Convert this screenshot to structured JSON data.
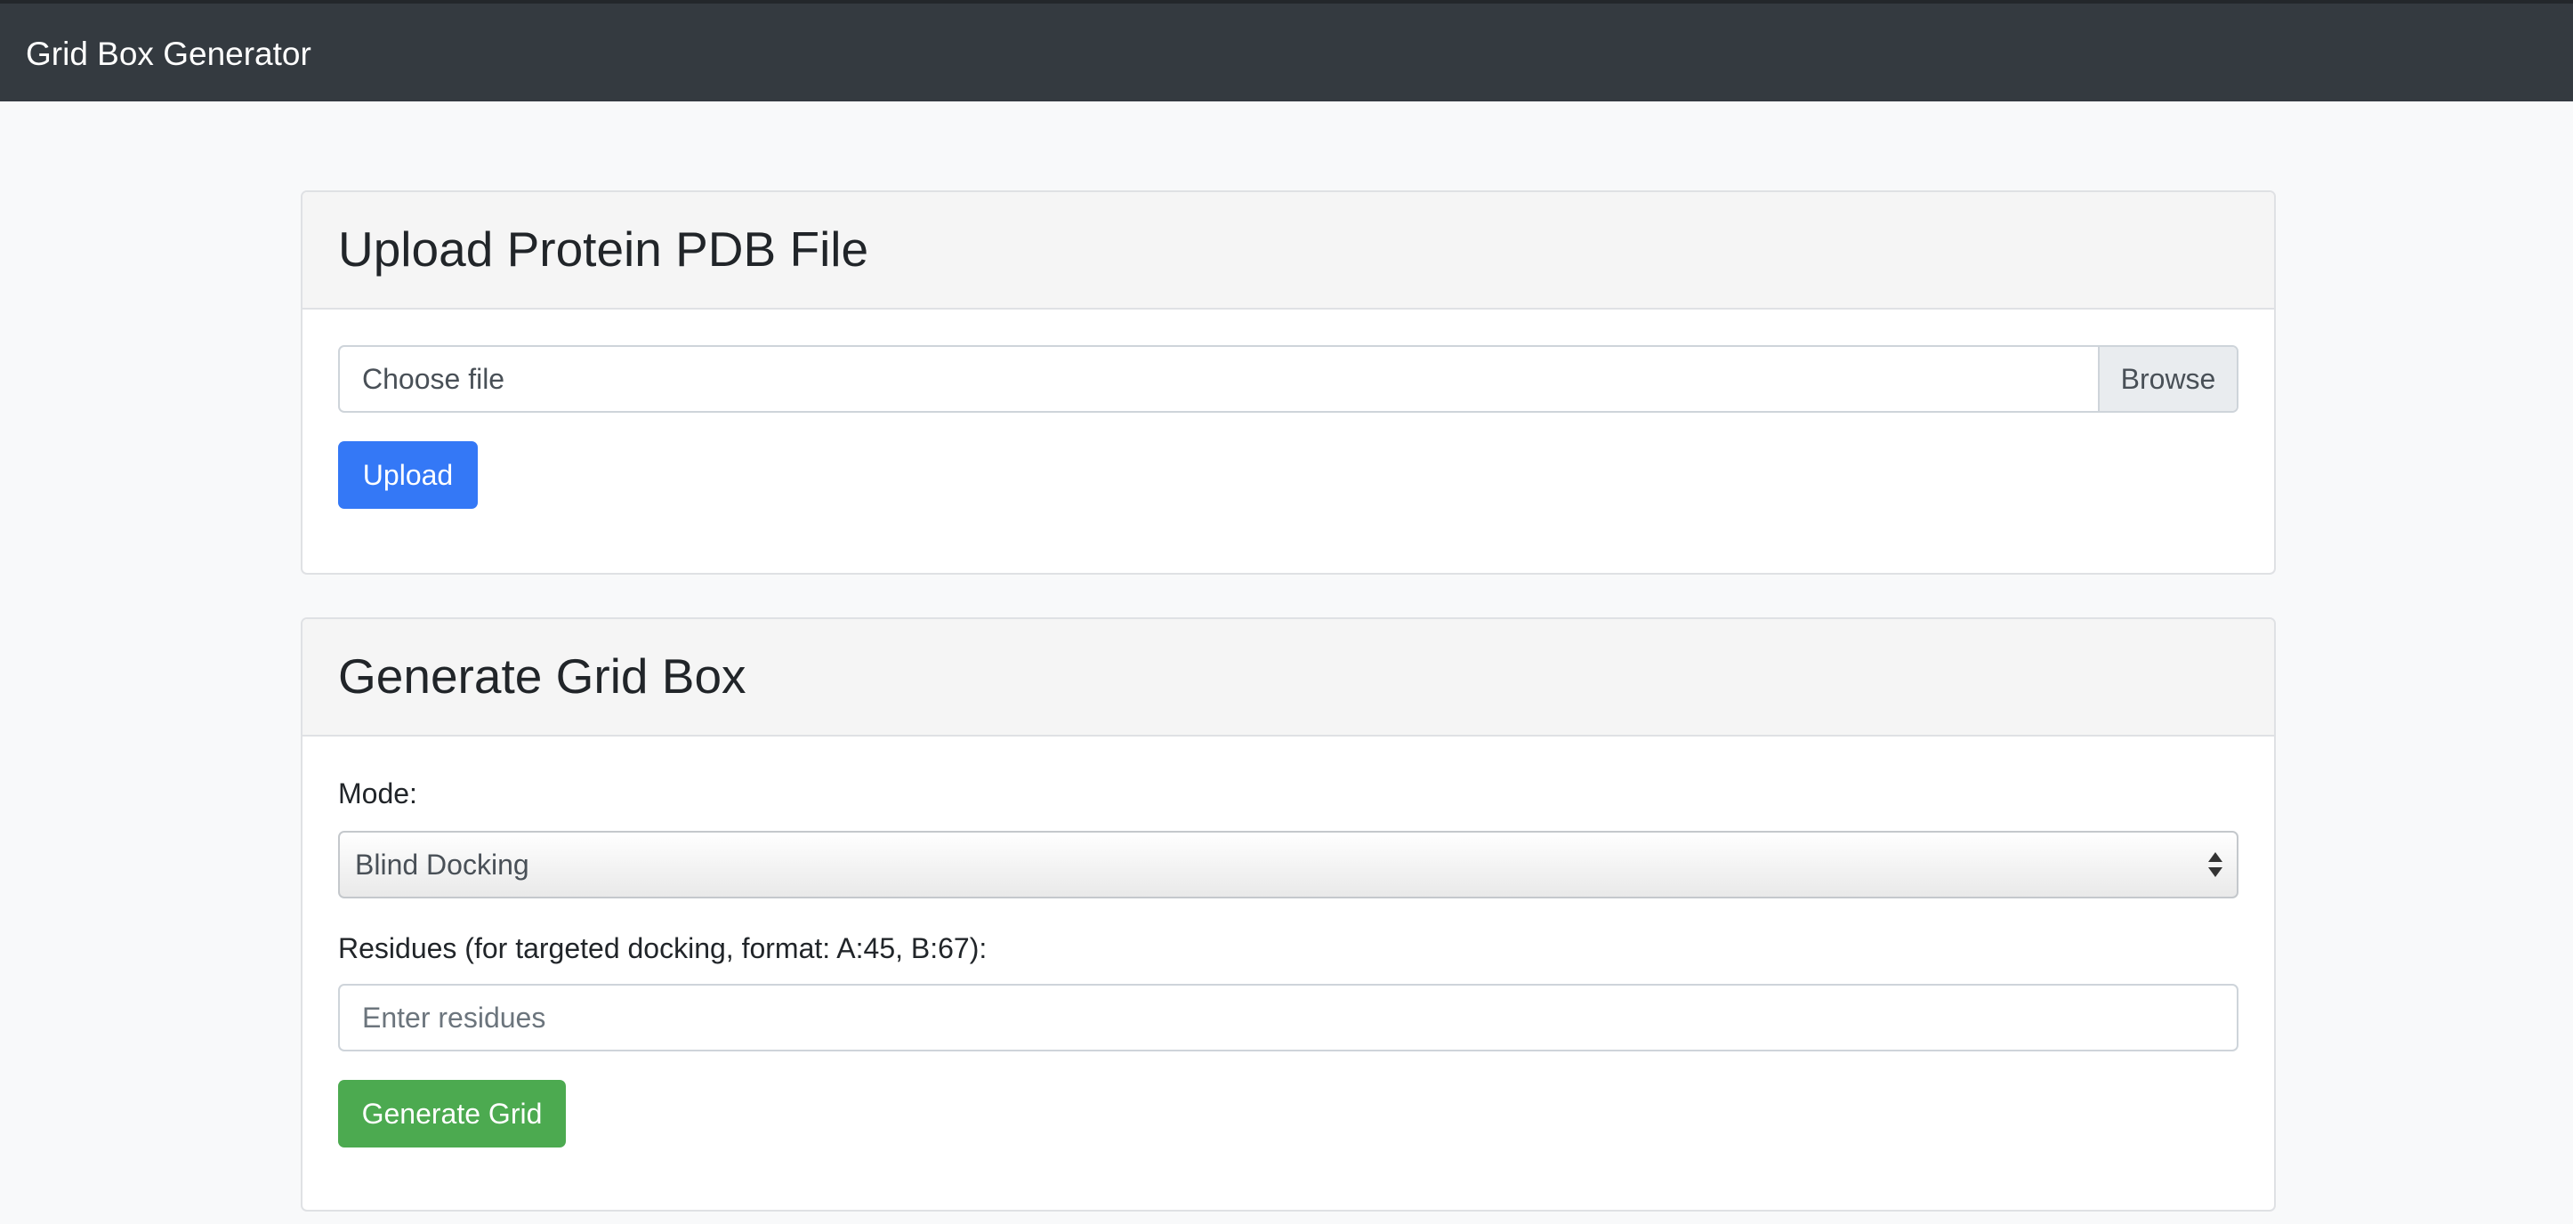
{
  "navbar": {
    "brand": "Grid Box Generator"
  },
  "upload_card": {
    "title": "Upload Protein PDB File",
    "file_placeholder": "Choose file",
    "browse_label": "Browse",
    "upload_button": "Upload"
  },
  "grid_card": {
    "title": "Generate Grid Box",
    "mode_label": "Mode:",
    "mode_selected": "Blind Docking",
    "residues_label": "Residues (for targeted docking, format: A:45, B:67):",
    "residues_placeholder": "Enter residues",
    "generate_button": "Generate Grid"
  },
  "colors": {
    "navbar_bg": "#343a40",
    "page_bg": "#f8f9fa",
    "primary": "#3478f6",
    "success": "#4caa50"
  },
  "icons": {
    "select_arrows": "select-arrows-icon"
  }
}
